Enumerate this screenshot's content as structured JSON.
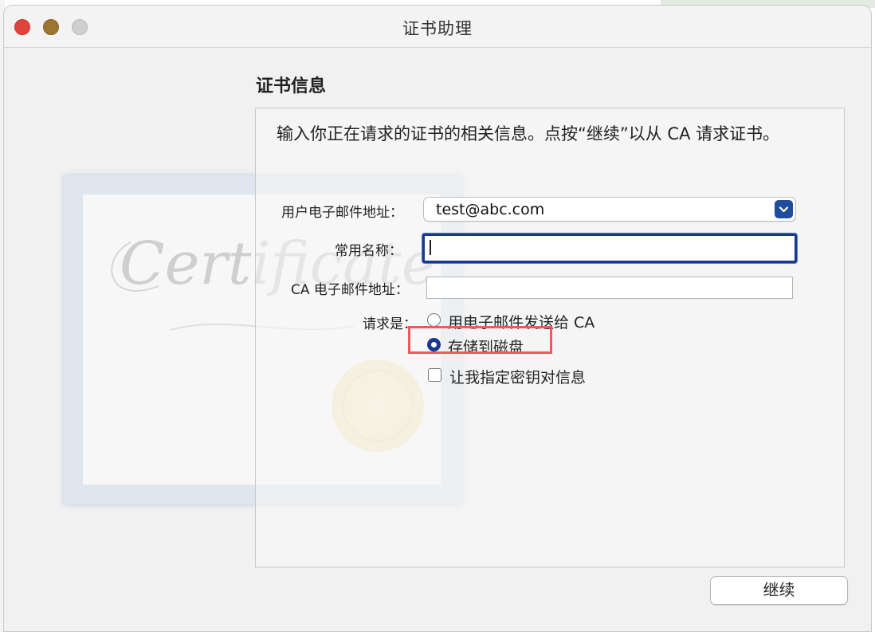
{
  "window": {
    "title": "证书助理"
  },
  "watermark": {
    "text": "Certificate"
  },
  "section": {
    "title": "证书信息",
    "description": "输入你正在请求的证书的相关信息。点按“继续”以从 CA 请求证书。"
  },
  "form": {
    "user_email_label": "用户电子邮件地址：",
    "user_email_value": "test@abc.com",
    "common_name_label": "常用名称：",
    "common_name_value": "",
    "ca_email_label": "CA 电子邮件地址：",
    "ca_email_value": "",
    "request_label": "请求是：",
    "request_options": [
      {
        "label": "用电子邮件发送给 CA",
        "selected": false
      },
      {
        "label": "存储到磁盘",
        "selected": true
      }
    ],
    "key_pair_checkbox_label": "让我指定密钥对信息",
    "key_pair_checked": false
  },
  "buttons": {
    "continue_label": "继续"
  },
  "colors": {
    "accent": "#173a8f",
    "highlight": "#ec5b5b",
    "close": "#e0433b",
    "minimize": "#9c7530",
    "maximize": "#cfcfcf"
  },
  "icons": {
    "combo_arrow": "chevron-down-icon"
  }
}
